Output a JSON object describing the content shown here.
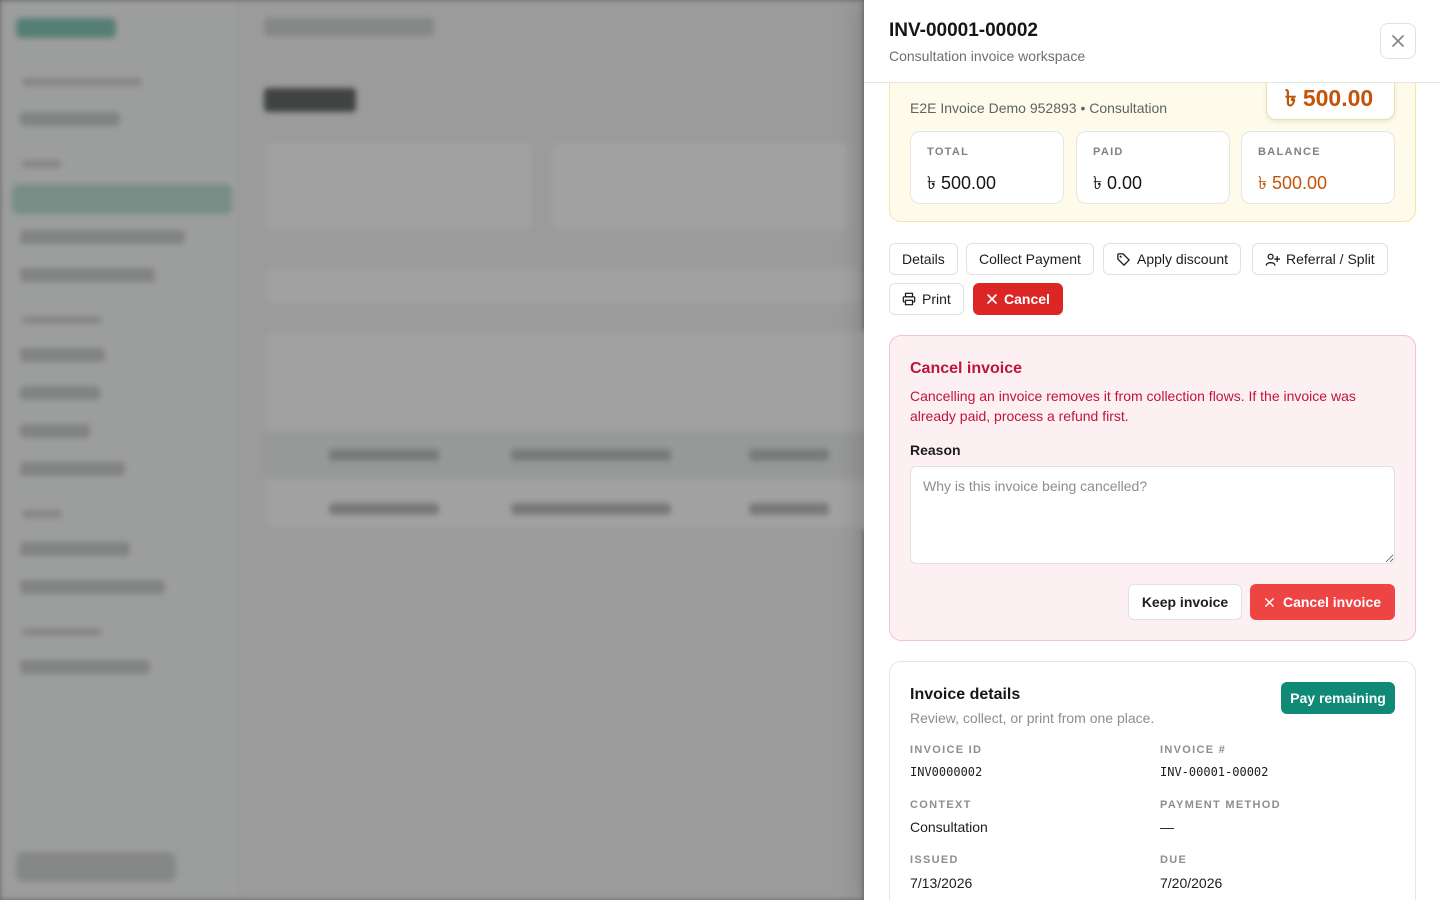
{
  "drawer": {
    "title": "INV-00001-00002",
    "subtitle": "Consultation invoice workspace",
    "close_icon": "✕"
  },
  "summary": {
    "meta": "E2E Invoice Demo 952893 • Consultation",
    "amount": "৳ 500.00",
    "stats": [
      {
        "label": "TOTAL",
        "value": "৳ 500.00"
      },
      {
        "label": "PAID",
        "value": "৳ 0.00"
      },
      {
        "label": "BALANCE",
        "value": "৳ 500.00"
      }
    ],
    "accent_color": "#c2540a"
  },
  "actions": {
    "details": "Details",
    "collect_payment": "Collect Payment",
    "apply_discount": "Apply discount",
    "referral_split": "Referral / Split",
    "print": "Print",
    "cancel": "Cancel"
  },
  "cancel_panel": {
    "title": "Cancel invoice",
    "description": "Cancelling an invoice removes it from collection flows. If the invoice was already paid, process a refund first.",
    "reason_label": "Reason",
    "reason_placeholder": "Why is this invoice being cancelled?",
    "reason_value": "",
    "keep_label": "Keep invoice",
    "confirm_label": "Cancel invoice",
    "danger_color": "#ef4444"
  },
  "details": {
    "title": "Invoice details",
    "subtitle": "Review, collect, or print from one place.",
    "pay_remaining": "Pay remaining",
    "fields": {
      "invoice_id": {
        "label": "INVOICE ID",
        "value": "INV0000002"
      },
      "invoice_number": {
        "label": "INVOICE #",
        "value": "INV-00001-00002"
      },
      "context": {
        "label": "CONTEXT",
        "value": "Consultation"
      },
      "payment_method": {
        "label": "PAYMENT METHOD",
        "value": "—"
      },
      "issued": {
        "label": "ISSUED",
        "value": "7/13/2026"
      },
      "due": {
        "label": "DUE",
        "value": "7/20/2026"
      }
    },
    "brand_color": "#0f8a76"
  }
}
